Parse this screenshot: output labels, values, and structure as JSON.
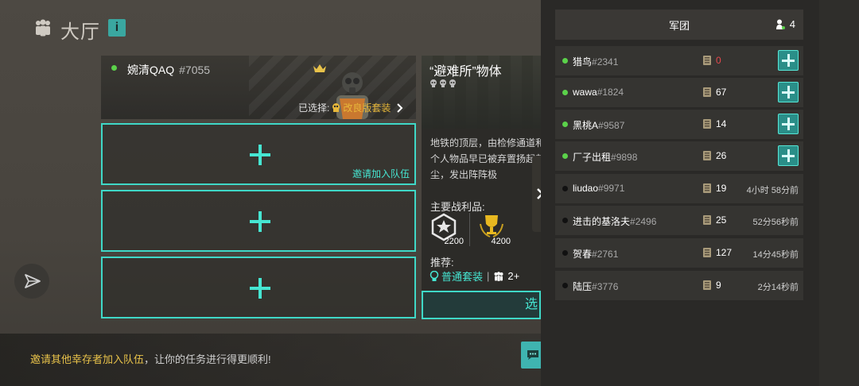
{
  "header": {
    "title": "大厅",
    "info_label": "i"
  },
  "player": {
    "name": "婉清QAQ",
    "tag": "#7055",
    "selected_label": "已选择:",
    "selected_kit": "改良版套装"
  },
  "invite_slots": [
    {
      "label": "邀请加入队伍"
    },
    {
      "label": ""
    },
    {
      "label": ""
    }
  ],
  "mission": {
    "title": "“避难所”物体",
    "description": "地铁的顶层，由检修通道和个人物品早已被弃置扬起灰尘，发出阵阵极",
    "loot_label": "主要战利品:",
    "loot": [
      {
        "icon": "rank-badge-icon",
        "value": "2200"
      },
      {
        "icon": "trophy-icon",
        "value": "4200"
      }
    ],
    "recommend_label": "推荐:",
    "recommend_kit": "普通套装",
    "recommend_people": "2+",
    "select_label": "选"
  },
  "banner": {
    "highlight": "邀请其他幸存者加入队伍",
    "rest": "，让你的任务进行得更顺利!"
  },
  "legion": {
    "title": "军团",
    "online_count": "4",
    "members": [
      {
        "name": "猎鸟",
        "tag": "#2341",
        "online": true,
        "level": "0",
        "level_red": true,
        "last_seen": ""
      },
      {
        "name": "wawa",
        "tag": "#1824",
        "online": true,
        "level": "67",
        "level_red": false,
        "last_seen": ""
      },
      {
        "name": "黑桃A",
        "tag": "#9587",
        "online": true,
        "level": "14",
        "level_red": false,
        "last_seen": ""
      },
      {
        "name": "厂子出租",
        "tag": "#9898",
        "online": true,
        "level": "26",
        "level_red": false,
        "last_seen": ""
      },
      {
        "name": "liudao",
        "tag": "#9971",
        "online": false,
        "level": "19",
        "level_red": false,
        "last_seen": "4小时 58分前"
      },
      {
        "name": "进击的基洛夫",
        "tag": "#2496",
        "online": false,
        "level": "25",
        "level_red": false,
        "last_seen": "52分56秒前"
      },
      {
        "name": "贺春",
        "tag": "#2761",
        "online": false,
        "level": "127",
        "level_red": false,
        "last_seen": "14分45秒前"
      },
      {
        "name": "陆压",
        "tag": "#3776",
        "online": false,
        "level": "9",
        "level_red": false,
        "last_seen": "2分14秒前"
      }
    ]
  },
  "colors": {
    "accent": "#46e6d2",
    "online": "#5bd24a",
    "gold": "#e8b83a",
    "warning_red": "#e5484d"
  }
}
